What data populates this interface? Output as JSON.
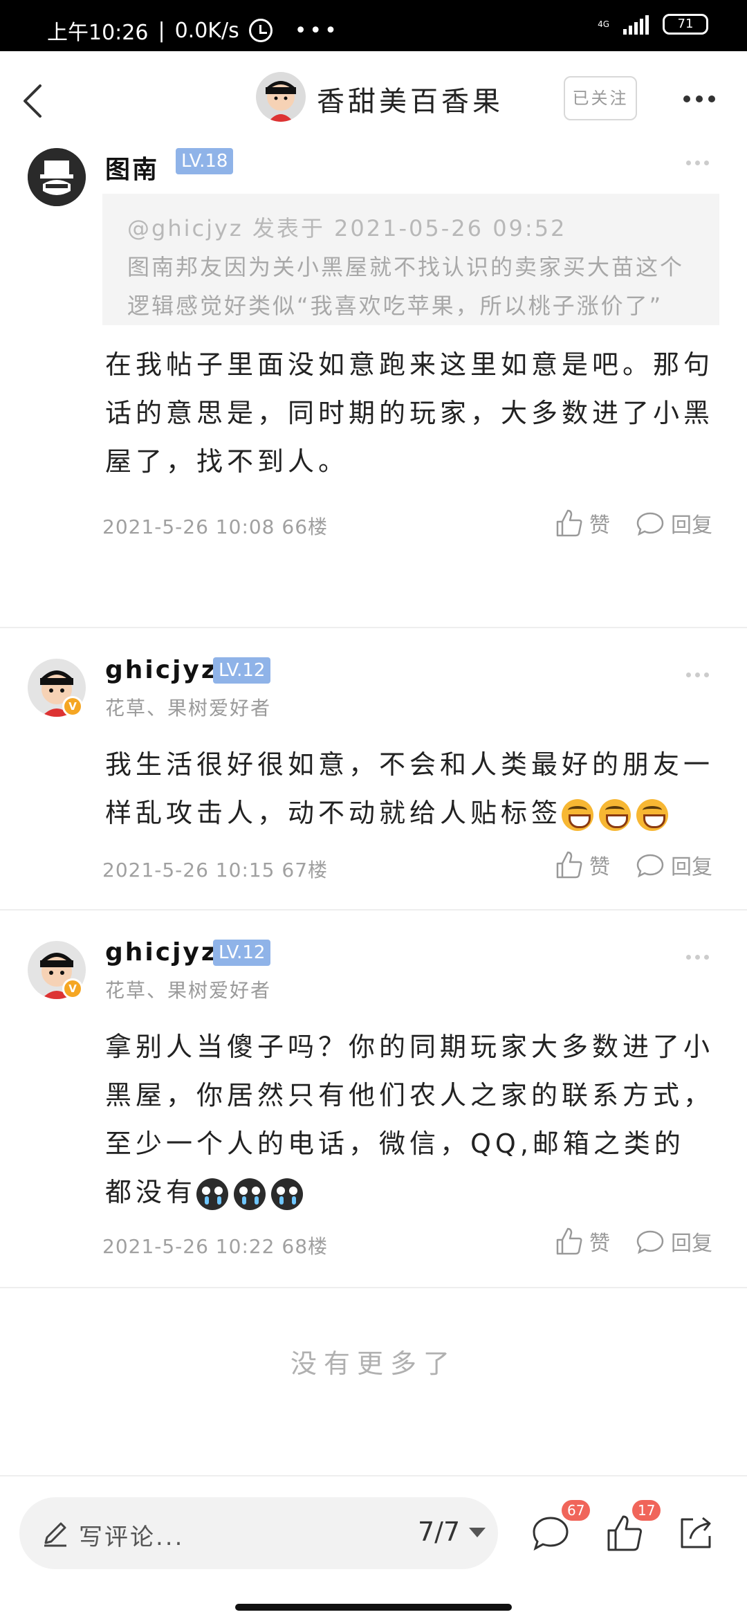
{
  "status_bar": {
    "time": "上午10:26",
    "network_speed": "0.0K/s",
    "network_type": "4G",
    "battery": "71",
    "overflow_dots": "•••"
  },
  "header": {
    "username": "香甜美百香果",
    "follow_label": "已关注"
  },
  "comments": [
    {
      "name": "图南",
      "level": "LV.18",
      "quote": {
        "meta": "@ghicjyz 发表于 2021-05-26 09:52",
        "text": "图南邦友因为关小黑屋就不找认识的卖家买大苗这个逻辑感觉好类似“我喜欢吃苹果，所以桃子涨价了”"
      },
      "text": "在我帖子里面没如意跑来这里如意是吧。那句话的意思是，同时期的玩家，大多数进了小黑屋了，找不到人。",
      "timestamp": "2021-5-26 10:08",
      "floor": "66楼",
      "like_label": "赞",
      "reply_label": "回复"
    },
    {
      "name": "ghicjyz",
      "level": "LV.12",
      "subtitle": "花草、果树爱好者",
      "text": "我生活很好很如意，不会和人类最好的朋友一样乱攻击人，动不动就给人贴标签",
      "timestamp": "2021-5-26 10:15",
      "floor": "67楼",
      "like_label": "赞",
      "reply_label": "回复"
    },
    {
      "name": "ghicjyz",
      "level": "LV.12",
      "subtitle": "花草、果树爱好者",
      "text": "拿别人当傻子吗？你的同期玩家大多数进了小黑屋，你居然只有他们农人之家的联系方式，至少一个人的电话，微信，QQ,邮箱之类的都没有",
      "timestamp": "2021-5-26 10:22",
      "floor": "68楼",
      "like_label": "赞",
      "reply_label": "回复"
    }
  ],
  "end_text": "没有更多了",
  "bottom_bar": {
    "input_placeholder": "写评论...",
    "page_indicator": "7/7",
    "comment_count": "67",
    "like_count": "17"
  },
  "colors": {
    "level_badge": "#8fb3e8",
    "count_badge": "#f0655a",
    "verified_badge": "#f5a623"
  },
  "icons": [
    "back-icon",
    "more-icon",
    "like-icon",
    "reply-icon",
    "pencil-icon",
    "comment-icon",
    "share-icon",
    "alarm-icon",
    "signal-icon",
    "battery-icon"
  ]
}
